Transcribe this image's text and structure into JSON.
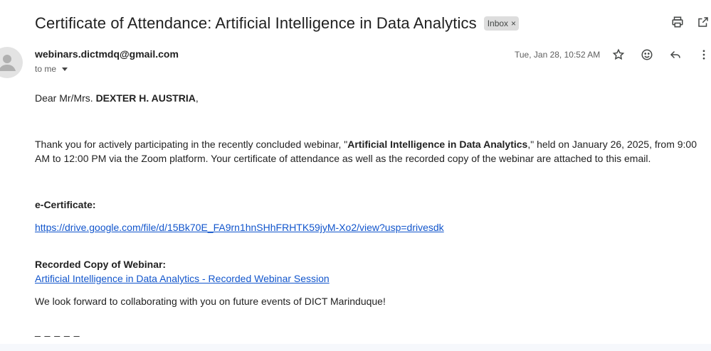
{
  "email": {
    "subject": "Certificate of Attendance: Artificial Intelligence in Data Analytics",
    "label": "Inbox",
    "label_close": "×",
    "sender": "webinars.dictmdq@gmail.com",
    "recipient": "to me",
    "date": "Tue, Jan 28, 10:52 AM"
  },
  "icons": {
    "top": [
      "print-icon",
      "open-in-new-window-icon"
    ],
    "message": [
      "star-icon",
      "emoji-reaction-icon",
      "reply-icon",
      "more-options-icon"
    ]
  },
  "body": {
    "greeting_prefix": "Dear Mr/Mrs. ",
    "greeting_name": "DEXTER H. AUSTRIA",
    "greeting_suffix": ",",
    "para1_prefix": "Thank you for actively participating in the recently concluded webinar, \"",
    "para1_title": "Artificial Intelligence in Data Analytics",
    "para1_suffix": ",\" held on January 26, 2025, from 9:00 AM to 12:00 PM via the Zoom platform. Your certificate of attendance as well as the recorded copy of the webinar are attached to this email.",
    "ecert_heading": "e-Certificate:",
    "ecert_link": "https://drive.google.com/file/d/15Bk70E_FA9rn1hnSHhFRHTK59jyM-Xo2/view?usp=drivesdk",
    "recording_heading": "Recorded Copy of Webinar:",
    "recording_link": "Artificial Intelligence in Data Analytics - Recorded Webinar Session",
    "closing": "We look forward to collaborating with you on future events of DICT Marinduque!",
    "separator": "_ _ _ _ _"
  }
}
